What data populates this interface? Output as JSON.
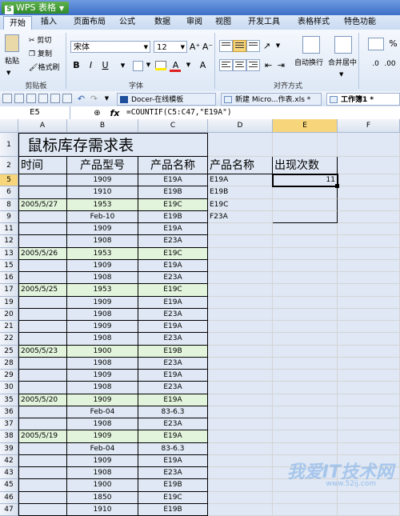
{
  "app": {
    "name": "WPS 表格"
  },
  "menu": [
    "开始",
    "插入",
    "页面布局",
    "公式",
    "数据",
    "审阅",
    "视图",
    "开发工具",
    "表格样式",
    "特色功能"
  ],
  "ribbon": {
    "paste": "粘贴",
    "cut": "剪切",
    "copy": "复制",
    "format_painter": "格式刷",
    "clipboard_group": "剪贴板",
    "font_name": "宋体",
    "font_size": "12",
    "grow_font": "A⁺",
    "shrink_font": "A⁻",
    "bold": "B",
    "italic": "I",
    "underline": "U",
    "font_group": "字体",
    "wrap_text": "自动换行",
    "merge_center": "合并居中",
    "align_group": "对齐方式",
    "pct": "%"
  },
  "doc_tabs": [
    "Docer-在线模板",
    "新建 Micro...作表.xls *",
    "工作簿1 *"
  ],
  "name_box": "E5",
  "formula": "=COUNTIF(C5:C47,\"E19A\")",
  "columns": [
    "A",
    "B",
    "C",
    "D",
    "E",
    "F"
  ],
  "sheet": {
    "title": "鼠标库存需求表",
    "headers": [
      "时间",
      "产品型号",
      "产品名称",
      "产品名称",
      "出现次数"
    ],
    "side": [
      {
        "name": "E19A",
        "count": "11"
      },
      {
        "name": "E19B",
        "count": ""
      },
      {
        "name": "E19C",
        "count": ""
      },
      {
        "name": "F23A",
        "count": ""
      }
    ],
    "rows": [
      {
        "n": "5",
        "date": "",
        "model": "1909",
        "name": "E19A",
        "g": false
      },
      {
        "n": "6",
        "date": "",
        "model": "1910",
        "name": "E19B",
        "g": false
      },
      {
        "n": "8",
        "date": "2005/5/27",
        "model": "1953",
        "name": "E19C",
        "g": true
      },
      {
        "n": "9",
        "date": "",
        "model": "Feb-10",
        "name": "E19B",
        "g": false
      },
      {
        "n": "11",
        "date": "",
        "model": "1909",
        "name": "E19A",
        "g": false
      },
      {
        "n": "12",
        "date": "",
        "model": "1908",
        "name": "E23A",
        "g": false
      },
      {
        "n": "13",
        "date": "2005/5/26",
        "model": "1953",
        "name": "E19C",
        "g": true
      },
      {
        "n": "15",
        "date": "",
        "model": "1909",
        "name": "E19A",
        "g": false
      },
      {
        "n": "16",
        "date": "",
        "model": "1908",
        "name": "E23A",
        "g": false
      },
      {
        "n": "17",
        "date": "2005/5/25",
        "model": "1953",
        "name": "E19C",
        "g": true
      },
      {
        "n": "19",
        "date": "",
        "model": "1909",
        "name": "E19A",
        "g": false
      },
      {
        "n": "20",
        "date": "",
        "model": "1908",
        "name": "E23A",
        "g": false
      },
      {
        "n": "21",
        "date": "",
        "model": "1909",
        "name": "E19A",
        "g": false
      },
      {
        "n": "22",
        "date": "",
        "model": "1908",
        "name": "E23A",
        "g": false
      },
      {
        "n": "25",
        "date": "2005/5/23",
        "model": "1900",
        "name": "E19B",
        "g": true
      },
      {
        "n": "28",
        "date": "",
        "model": "1908",
        "name": "E23A",
        "g": false
      },
      {
        "n": "29",
        "date": "",
        "model": "1909",
        "name": "E19A",
        "g": false
      },
      {
        "n": "30",
        "date": "",
        "model": "1908",
        "name": "E23A",
        "g": false
      },
      {
        "n": "35",
        "date": "2005/5/20",
        "model": "1909",
        "name": "E19A",
        "g": true
      },
      {
        "n": "36",
        "date": "",
        "model": "Feb-04",
        "name": "83-6.3",
        "g": false
      },
      {
        "n": "37",
        "date": "",
        "model": "1908",
        "name": "E23A",
        "g": false
      },
      {
        "n": "38",
        "date": "2005/5/19",
        "model": "1909",
        "name": "E19A",
        "g": true
      },
      {
        "n": "39",
        "date": "",
        "model": "Feb-04",
        "name": "83-6.3",
        "g": false
      },
      {
        "n": "42",
        "date": "",
        "model": "1909",
        "name": "E19A",
        "g": false
      },
      {
        "n": "43",
        "date": "",
        "model": "1908",
        "name": "E23A",
        "g": false
      },
      {
        "n": "45",
        "date": "",
        "model": "1900",
        "name": "E19B",
        "g": false
      },
      {
        "n": "46",
        "date": "",
        "model": "1850",
        "name": "E19C",
        "g": false
      },
      {
        "n": "47",
        "date": "",
        "model": "1910",
        "name": "E19B",
        "g": false
      }
    ]
  },
  "watermark": {
    "text": "我爱IT技术网",
    "url": "www.52ij.com"
  }
}
